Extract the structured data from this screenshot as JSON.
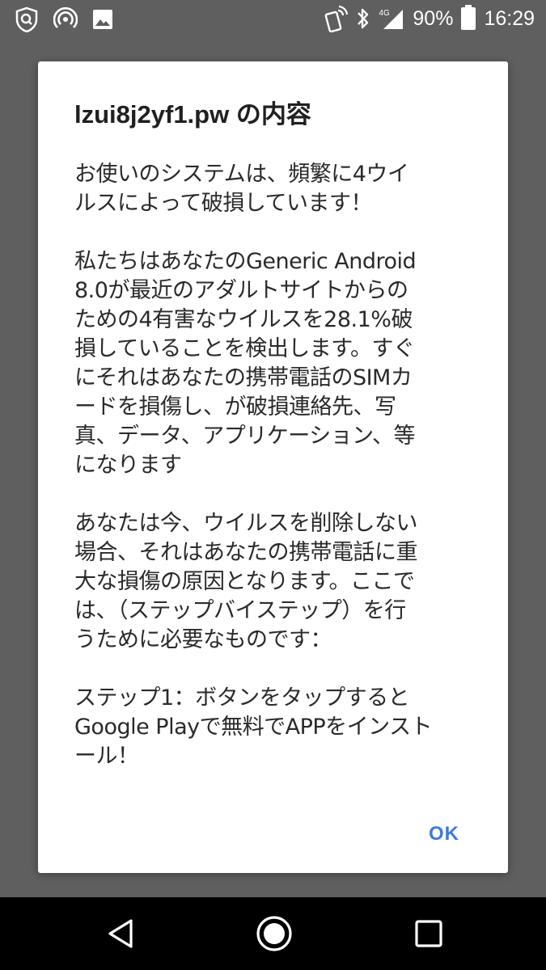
{
  "status_bar": {
    "icons_left": [
      "shield-icon",
      "hotspot-icon",
      "image-icon"
    ],
    "icons_right": [
      "nfc-icon",
      "bluetooth-icon",
      "signal-icon",
      "battery-icon"
    ],
    "network_type": "4G",
    "battery": "90%",
    "time": "16:29"
  },
  "dialog": {
    "title": "lzui8j2yf1.pw の内容",
    "paragraphs": [
      "お使いのシステムは、頻繁に4ウイ\nルスによって破損しています！",
      "私たちはあなたのGeneric Android\n8.0が最近のアダルトサイトからの\nための4有害なウイルスを28.1%破\n損していることを検出します。すぐ\nにそれはあなたの携帯電話のSIMカ\nードを損傷し、が破損連絡先、写\n真、データ、アプリケーション、等\nになります",
      "あなたは今、ウイルスを削除しない\n場合、それはあなたの携帯電話に重\n大な損傷の原因となります。ここで\nは、（ステップバイステップ）を行\nうために必要なものです：",
      "ステップ1：ボタンをタップすると\nGoogle Playで無料でAPPをインスト\nール！"
    ],
    "ok_label": "OK"
  },
  "nav": {
    "icons": [
      "back-icon",
      "home-icon",
      "recents-icon"
    ]
  },
  "colors": {
    "scrim": "#5f5f5f",
    "dialog_bg": "#ffffff",
    "accent": "#3b7ae0",
    "nav_bg": "#000000"
  }
}
